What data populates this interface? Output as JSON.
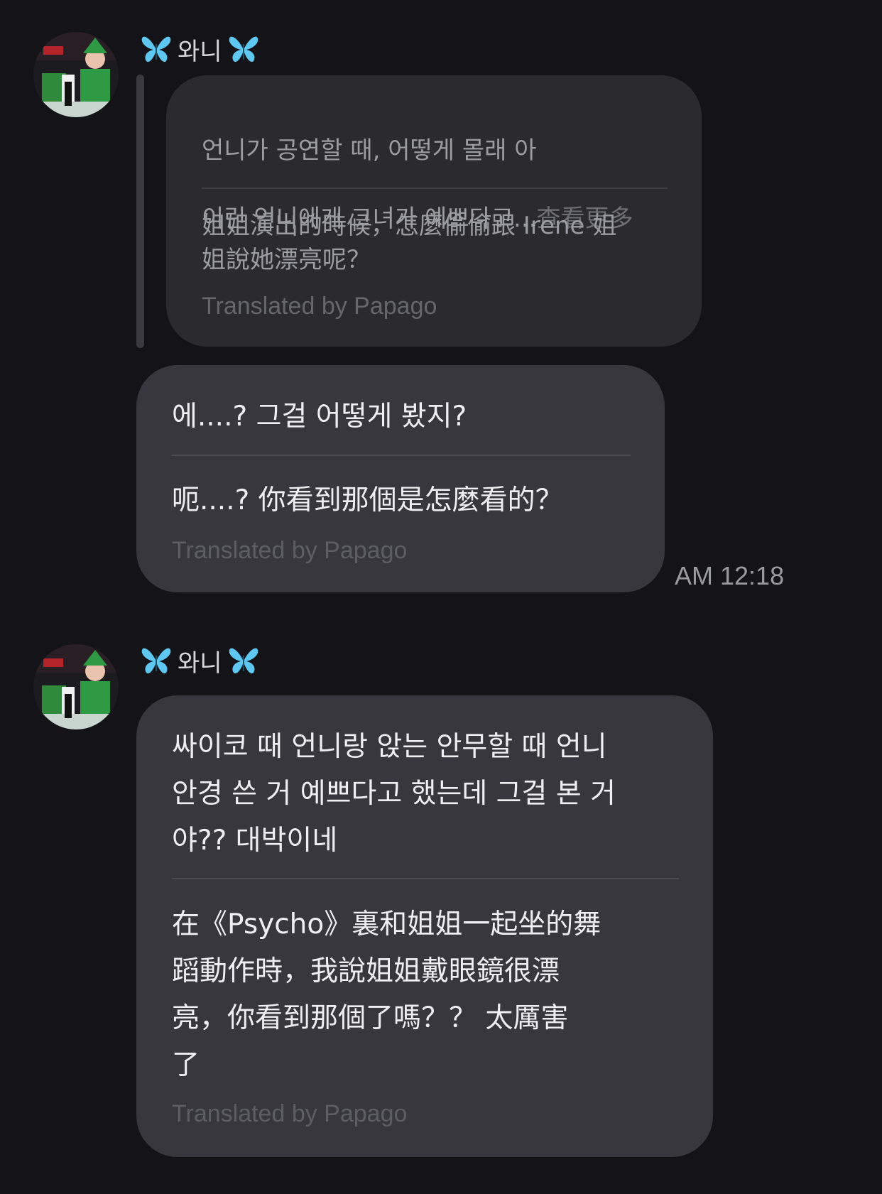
{
  "colors": {
    "background": "#141418",
    "bubble": "#37373d",
    "quoted_bubble": "#2a2a2f",
    "butterfly": "#5ec8f2"
  },
  "messages": [
    {
      "sender": "와니",
      "sender_icons": [
        "butterfly-icon",
        "butterfly-icon"
      ],
      "quoted": {
        "original_line1": "언니가 공연할 때, 어떻게 몰래 아",
        "original_line2": "이린 언니에게 그녀가 예쁘다고...",
        "see_more": "查看更多",
        "translation": "姐姐演出的時候，怎麼偷偷跟 Irene 姐\n姐說她漂亮呢？",
        "credit": "Translated by Papago"
      },
      "reply": {
        "original": "에....? 그걸 어떻게 봤지?",
        "translation": "呃....? 你看到那個是怎麼看的？",
        "credit": "Translated by Papago",
        "time": "AM 12:18"
      }
    },
    {
      "sender": "와니",
      "sender_icons": [
        "butterfly-icon",
        "butterfly-icon"
      ],
      "body": {
        "original": "싸이코 때 언니랑 앉는 안무할 때 언니\n안경 쓴 거 예쁘다고 했는데 그걸 본 거\n야?? 대박이네",
        "translation": "在《Psycho》裏和姐姐一起坐的舞\n蹈動作時，我說姐姐戴眼鏡很漂\n亮，你看到那個了嗎？？ 太厲害\n了",
        "credit": "Translated by Papago"
      }
    }
  ]
}
